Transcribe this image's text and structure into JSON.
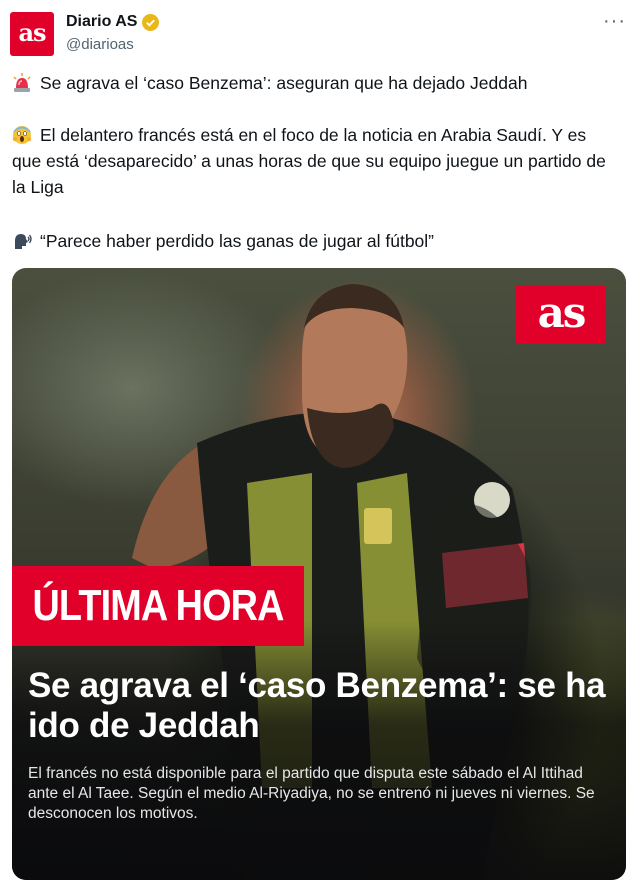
{
  "account": {
    "display_name": "Diario AS",
    "handle": "@diarioas",
    "avatar_text": "as"
  },
  "menu": {
    "more_label": "···"
  },
  "tweet": {
    "line1": {
      "emoji": "siren-emoji",
      "text": "Se agrava el ‘caso Benzema’: aseguran que ha dejado Jeddah"
    },
    "line2": {
      "emoji": "screaming-face-emoji",
      "text": "El delantero francés está en el foco de la noticia en Arabia Saudí. Y es que está ‘desaparecido’ a unas horas de que su equipo juegue un partido de la Liga"
    },
    "line3": {
      "emoji": "speaking-head-emoji",
      "text": "“Parece haber perdido las ganas de jugar al fútbol”"
    }
  },
  "card": {
    "logo_text": "as",
    "banner": "ÚLTIMA HORA",
    "headline": "Se agrava el ‘caso Benzema’: se ha ido de Jeddah",
    "subtext": "El francés no está disponible para el partido que disputa este sábado el Al Ittihad ante el Al Taee. Según el medio Al-Riyadiya, no se entrenó ni jueves ni viernes. Se desconocen los motivos."
  },
  "colors": {
    "brand_red": "#e0002a",
    "verified_gold": "#e8b71a",
    "text": "#0f1419",
    "muted": "#536471"
  }
}
